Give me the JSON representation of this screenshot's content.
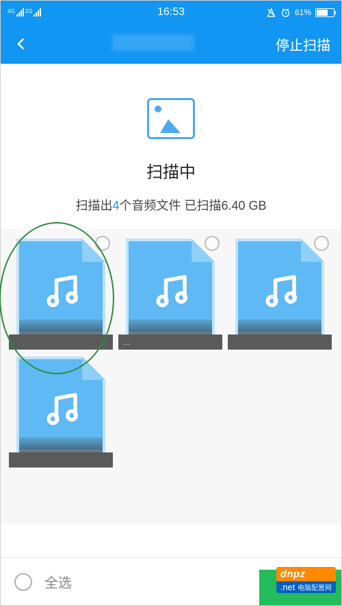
{
  "statusbar": {
    "net_label1": "4G",
    "net_label2": "2G",
    "time": "16:53",
    "battery_pct": "61%"
  },
  "header": {
    "stop_label": "停止扫描"
  },
  "scan": {
    "title": "扫描中",
    "prefix": "扫描出",
    "count": "4",
    "mid": "个音频文件 已扫描",
    "size": "6.40 GB"
  },
  "files": [
    {
      "label": ""
    },
    {
      "label": "…"
    },
    {
      "label": ""
    },
    {
      "label": ""
    }
  ],
  "footer": {
    "select_all": "全选"
  },
  "watermark": {
    "line1": "dnpz",
    "line2": ".net",
    "alt": "电脑配置网"
  }
}
